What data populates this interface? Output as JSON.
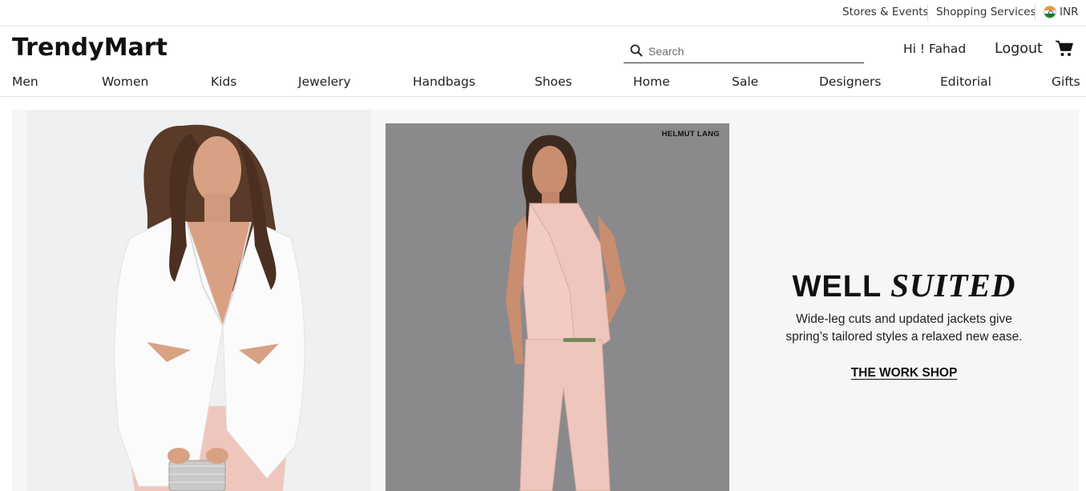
{
  "topbar": {
    "stores_events": "Stores & Events",
    "shopping_services": "Shopping Services",
    "currency": "INR",
    "flag_icon": "india-flag-icon"
  },
  "header": {
    "logo": "TrendyMart",
    "search_placeholder": "Search",
    "search_icon": "search-icon",
    "greeting": "Hi ! Fahad",
    "logout": "Logout",
    "cart_icon": "shopping-cart-icon"
  },
  "nav": {
    "items": [
      "Men",
      "Women",
      "Kids",
      "Jewelery",
      "Handbags",
      "Shoes",
      "Home",
      "Sale",
      "Designers",
      "Editorial",
      "Gifts"
    ]
  },
  "hero": {
    "brand_tag": "HELMUT LANG",
    "title_plain": "WELL",
    "title_italic": "SUITED",
    "text_line1": "Wide-leg cuts and updated jackets give",
    "text_line2": "spring’s tailored styles a relaxed new ease.",
    "cta": "THE WORK SHOP"
  },
  "colors": {
    "hero_background": "#f6f5f8",
    "left_panel_background": "#eef0f2",
    "right_panel_background": "#8a8a8c",
    "blazer_white": "#fbfbfb",
    "suit_pink": "#efc6bd"
  }
}
